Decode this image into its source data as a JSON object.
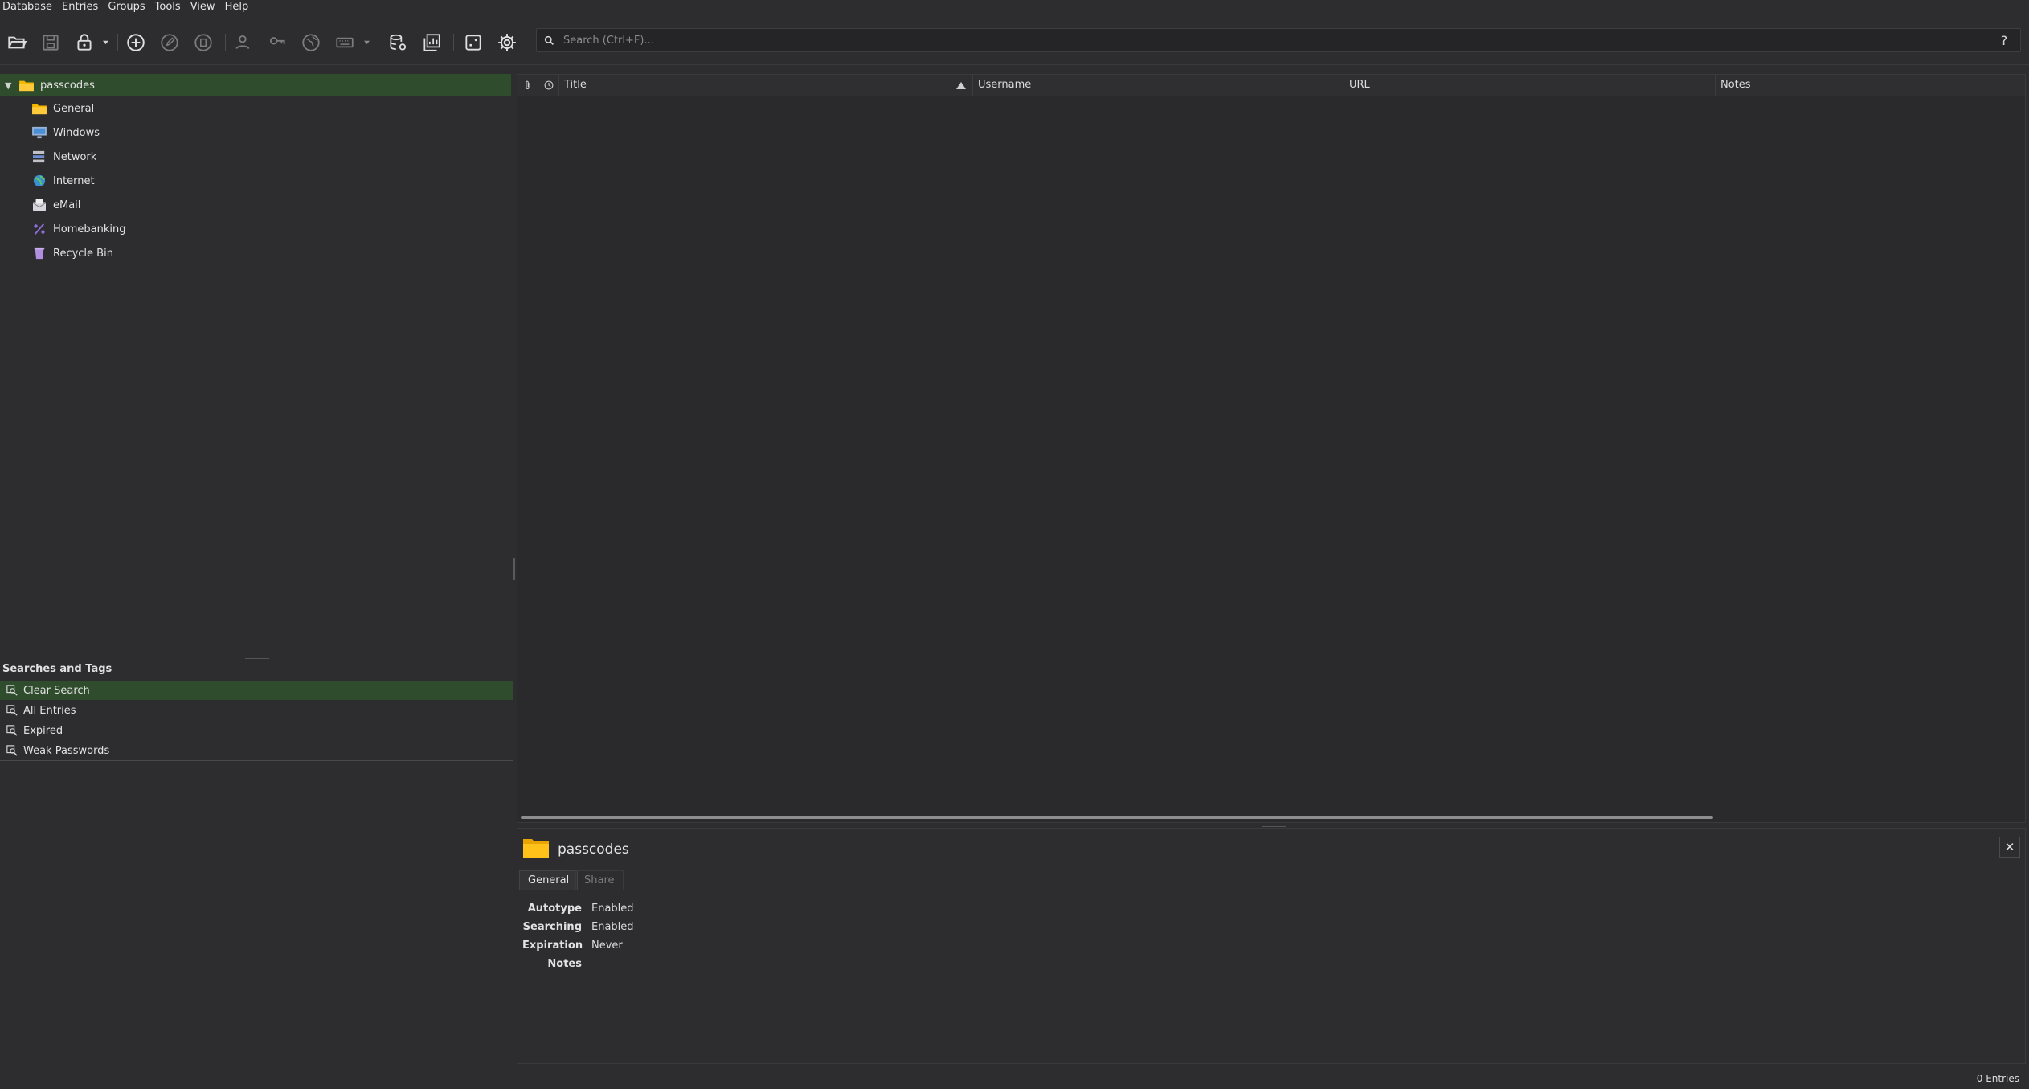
{
  "menu": [
    "Database",
    "Entries",
    "Groups",
    "Tools",
    "View",
    "Help"
  ],
  "search": {
    "placeholder": "Search (Ctrl+F)...",
    "help": "?"
  },
  "groups": {
    "root": "passcodes",
    "children": [
      {
        "label": "General",
        "icon": "folder-icon"
      },
      {
        "label": "Windows",
        "icon": "monitor-icon"
      },
      {
        "label": "Network",
        "icon": "network-server-icon"
      },
      {
        "label": "Internet",
        "icon": "globe-icon"
      },
      {
        "label": "eMail",
        "icon": "mail-icon"
      },
      {
        "label": "Homebanking",
        "icon": "percent-icon"
      },
      {
        "label": "Recycle Bin",
        "icon": "trash-icon"
      }
    ]
  },
  "searches": {
    "header": "Searches and Tags",
    "items": [
      "Clear Search",
      "All Entries",
      "Expired",
      "Weak Passwords"
    ]
  },
  "table": {
    "columns": [
      "Title",
      "Username",
      "URL",
      "Notes"
    ]
  },
  "details": {
    "group_name": "passcodes",
    "tabs": [
      "General",
      "Share"
    ],
    "props": [
      {
        "key": "Autotype",
        "value": "Enabled"
      },
      {
        "key": "Searching",
        "value": "Enabled"
      },
      {
        "key": "Expiration",
        "value": "Never"
      },
      {
        "key": "Notes",
        "value": ""
      }
    ]
  },
  "status": {
    "entries": "0 Entries"
  },
  "colors": {
    "selection": "#2f4d2d",
    "folder": "#f5b800",
    "background": "#2d2d2f"
  }
}
